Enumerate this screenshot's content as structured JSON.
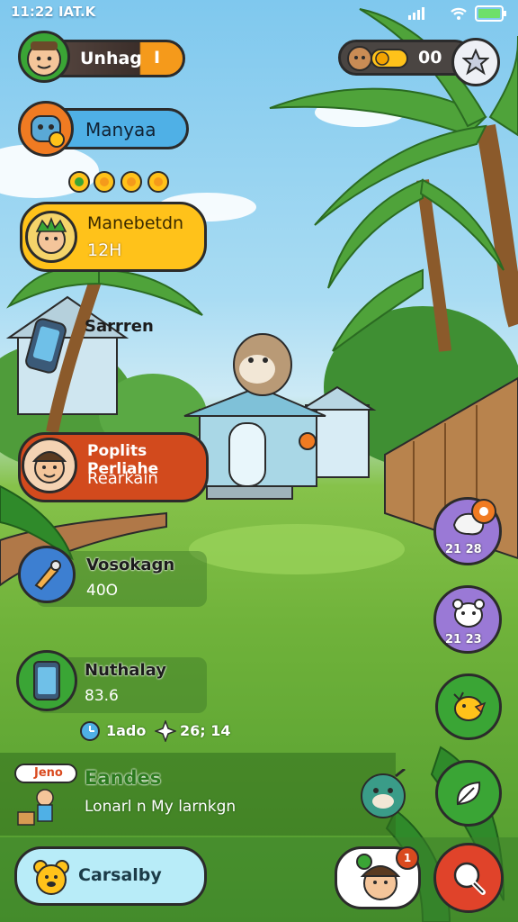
{
  "status_bar": {
    "time": "11:22 IAT.K"
  },
  "profile": {
    "name": "Unhag",
    "badge": "I"
  },
  "currency": {
    "value": "00"
  },
  "menu": [
    {
      "label": "Manyaa"
    },
    {
      "label": "Manebetdn",
      "sub": "12H"
    },
    {
      "label": "Sarrren"
    },
    {
      "label": "Poplits Perliahe",
      "sub": "Rearkain"
    },
    {
      "label": "Vosokagn",
      "sub": "40O"
    },
    {
      "label": "Nuthalay",
      "sub": "83.6"
    }
  ],
  "stats_row": {
    "a": "1ado",
    "b": "26; 14"
  },
  "event": {
    "badge": "Jeno",
    "title": "Eandes",
    "desc": "Lonarl n My larnkgn"
  },
  "right_slots": [
    {
      "count": "21 28"
    },
    {
      "count": "21 23"
    }
  ],
  "bottom": {
    "button_label": "Carsalby",
    "notify": "1"
  },
  "colors": {
    "orange": "#f59a1b",
    "blue": "#4fb0e6",
    "yellow": "#ffc21a",
    "red": "#d94a1f",
    "green": "#3aa535",
    "purple": "#9a79d6"
  }
}
